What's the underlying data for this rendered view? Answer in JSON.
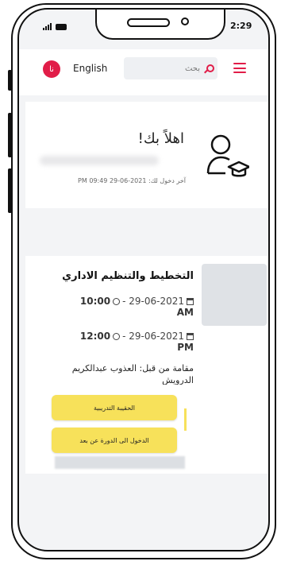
{
  "status": {
    "time": "2:29"
  },
  "header": {
    "avatar_initial": "نا",
    "language": "English",
    "search_placeholder": "بحث",
    "accent": "#e11d48"
  },
  "welcome": {
    "title": "اهلاً بك!",
    "last_login": "آخر دخول لك: 2021-06-29 09:49 PM"
  },
  "course": {
    "title": "التخطيط والتنظيم الاداري",
    "start_date": "29-06-2021 -",
    "start_time": "10:00",
    "start_ampm": "AM",
    "end_date": "29-06-2021 -",
    "end_time": "12:00",
    "end_ampm": "PM",
    "presented_by": "مقامة من قبل: العذوب عبدالكريم الدرويش",
    "training_bag_button": "الحقيبة التدريبية",
    "remote_join_button": "الدخول الى الدورة عن بعد"
  },
  "colors": {
    "button_yellow": "#f7e15a"
  }
}
